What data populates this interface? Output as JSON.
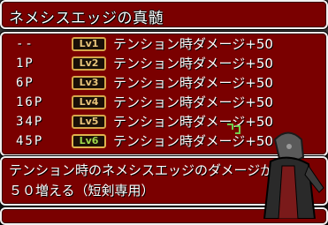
{
  "title": "ネメシスエッジの真髄",
  "rows": [
    {
      "requirement": "--",
      "level": "Lv1",
      "effect": "テンション時ダメージ+50"
    },
    {
      "requirement": "1P",
      "level": "Lv2",
      "effect": "テンション時ダメージ+50"
    },
    {
      "requirement": "6P",
      "level": "Lv3",
      "effect": "テンション時ダメージ+50"
    },
    {
      "requirement": "16P",
      "level": "Lv4",
      "effect": "テンション時ダメージ+50"
    },
    {
      "requirement": "34P",
      "level": "Lv5",
      "effect": "テンション時ダメージ+50"
    },
    {
      "requirement": "45P",
      "level": "Lv6",
      "effect": "テンション時ダメージ+50"
    }
  ],
  "description": {
    "line1": "テンション時のネメシスエッジのダメージが",
    "line2": "５０増える（短剣専用）"
  },
  "bottom_text": "",
  "colors": {
    "panel_red": "#7a0000",
    "panel_border": "#f0f0f0",
    "level_border": "#d6a64a",
    "level_text": "#e8c47a",
    "level_active_text": "#9fd84a"
  }
}
